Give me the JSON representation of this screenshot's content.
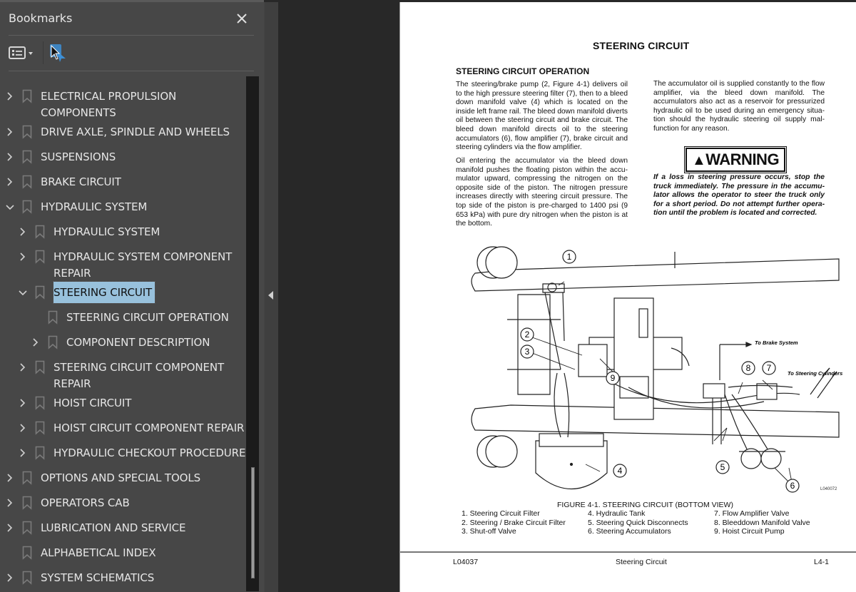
{
  "panel": {
    "title": "Bookmarks",
    "close_icon": "close-icon",
    "toolbar": {
      "options_icon": "list-options-icon",
      "find_icon": "find-current-bookmark-icon"
    }
  },
  "bookmarks": [
    {
      "label": "ELECTRICAL PROPULSION\nCOMPONENTS",
      "level": 0,
      "expander": "collapsed"
    },
    {
      "label": "DRIVE AXLE, SPINDLE AND WHEELS",
      "level": 0,
      "expander": "collapsed"
    },
    {
      "label": "SUSPENSIONS",
      "level": 0,
      "expander": "collapsed"
    },
    {
      "label": "BRAKE CIRCUIT",
      "level": 0,
      "expander": "collapsed"
    },
    {
      "label": "HYDRAULIC SYSTEM",
      "level": 0,
      "expander": "expanded"
    },
    {
      "label": "HYDRAULIC SYSTEM",
      "level": 1,
      "expander": "collapsed"
    },
    {
      "label": "HYDRAULIC SYSTEM COMPONENT\nREPAIR",
      "level": 1,
      "expander": "collapsed"
    },
    {
      "label": "STEERING CIRCUIT",
      "level": 1,
      "expander": "expanded",
      "selected": true
    },
    {
      "label": "STEERING CIRCUIT OPERATION",
      "level": 2,
      "expander": "none"
    },
    {
      "label": "COMPONENT DESCRIPTION",
      "level": 2,
      "expander": "collapsed"
    },
    {
      "label": "STEERING CIRCUIT COMPONENT\nREPAIR",
      "level": 1,
      "expander": "collapsed"
    },
    {
      "label": "HOIST CIRCUIT",
      "level": 1,
      "expander": "collapsed"
    },
    {
      "label": "HOIST CIRCUIT COMPONENT REPAIR",
      "level": 1,
      "expander": "collapsed"
    },
    {
      "label": "HYDRAULIC CHECKOUT PROCEDURE",
      "level": 1,
      "expander": "collapsed"
    },
    {
      "label": "OPTIONS AND SPECIAL TOOLS",
      "level": 0,
      "expander": "collapsed"
    },
    {
      "label": "OPERATORS CAB",
      "level": 0,
      "expander": "collapsed"
    },
    {
      "label": "LUBRICATION AND SERVICE",
      "level": 0,
      "expander": "collapsed"
    },
    {
      "label": "ALPHABETICAL INDEX",
      "level": 0,
      "expander": "none"
    },
    {
      "label": "SYSTEM SCHEMATICS",
      "level": 0,
      "expander": "collapsed"
    }
  ],
  "colors": {
    "panel_bg": "#474747",
    "selected_bg": "#98c1dc",
    "viewer_bg": "#282828",
    "page_bg": "#ffffff"
  },
  "document": {
    "title": "STEERING CIRCUIT",
    "section_heading": "STEERING CIRCUIT OPERATION",
    "paragraph1": "The steering/brake pump (2, Figure 4-1) delivers oil to the high pressure steering filter (7), then to a bleed down manifold valve (4) which is located on the inside left frame rail. The bleed down manifold diverts oil between the steering circuit and brake cir­cuit. The bleed down manifold directs oil to the steering accumulators (6), flow amplifier (7), brake circuit and steering cylinders via the flow amplifier.",
    "paragraph2": "Oil entering the accumulator via the bleed down manifold pushes the floating piston within the accu­mulator upward, compressing the nitrogen on the opposite side of the piston. The nitrogen pressure increases directly with steering circuit pressure. The top side of the piston is pre-charged to 1400 psi (9 653 kPa) with pure dry nitrogen when the piston is at the bottom.",
    "paragraph3": "The accumulator oil is supplied constantly to the flow amplifier, via the bleed down manifold. The accumulators also act as a reservoir for pressurized hydraulic oil to be used during an emergency situa­tion should the hydraulic steering oil supply mal­function for any reason.",
    "warning_label": "WARNING",
    "warning_icon": "warning-triangle-icon",
    "warning_text": "If a loss in steering pressure occurs, stop the truck immediately. The pressure in the accumu­lator allows the operator to steer the truck only for a short period. Do not attempt further opera­tion until the problem is located and corrected.",
    "figure": {
      "callouts": [
        "1",
        "2",
        "3",
        "4",
        "5",
        "6",
        "7",
        "8",
        "9"
      ],
      "annotation_brake": "To Brake System",
      "annotation_cylinders": "To Steering Cylinders",
      "image_code": "L040072",
      "caption": "FIGURE 4-1. STEERING CIRCUIT (BOTTOM VIEW)",
      "legend": [
        [
          "1. Steering Circuit Filter",
          "2. Steering / Brake Circuit Filter",
          "3. Shut-off Valve"
        ],
        [
          "4. Hydraulic Tank",
          "5. Steering Quick Disconnects",
          "6. Steering Accumulators"
        ],
        [
          "7. Flow Amplifier Valve",
          "8. Bleeddown Manifold Valve",
          "9. Hoist Circuit Pump"
        ]
      ]
    },
    "footer": {
      "left": "L04037",
      "center": "Steering Circuit",
      "right": "L4-1"
    }
  }
}
